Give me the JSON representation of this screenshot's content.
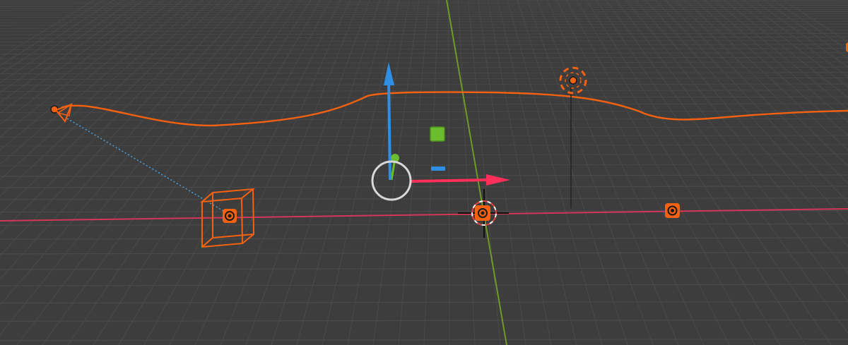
{
  "viewport": {
    "background": "#3d3d3d",
    "grid_color": "#4a4a4a",
    "x_axis_color": "#d2365a",
    "y_axis_color": "#6e9a2a",
    "selection_color": "#f36111",
    "cursor_color": "#ffffff"
  },
  "objects": [
    {
      "name": "camera",
      "icon": "camera-icon",
      "selected": true
    },
    {
      "name": "curve",
      "icon": "curve-icon",
      "selected": true
    },
    {
      "name": "light-sun",
      "icon": "light-icon",
      "selected": true
    },
    {
      "name": "cube",
      "icon": "cube-icon",
      "selected": true
    },
    {
      "name": "empty",
      "icon": "empty-icon",
      "selected": true
    },
    {
      "name": "3d-cursor",
      "icon": "crosshair-icon",
      "selected": false
    }
  ],
  "gizmo": {
    "mode": "move",
    "axes": [
      "x",
      "y",
      "z"
    ],
    "colors": {
      "x": "#ff2f5a",
      "y": "#6bbd2e",
      "z": "#2f8fe5"
    }
  }
}
